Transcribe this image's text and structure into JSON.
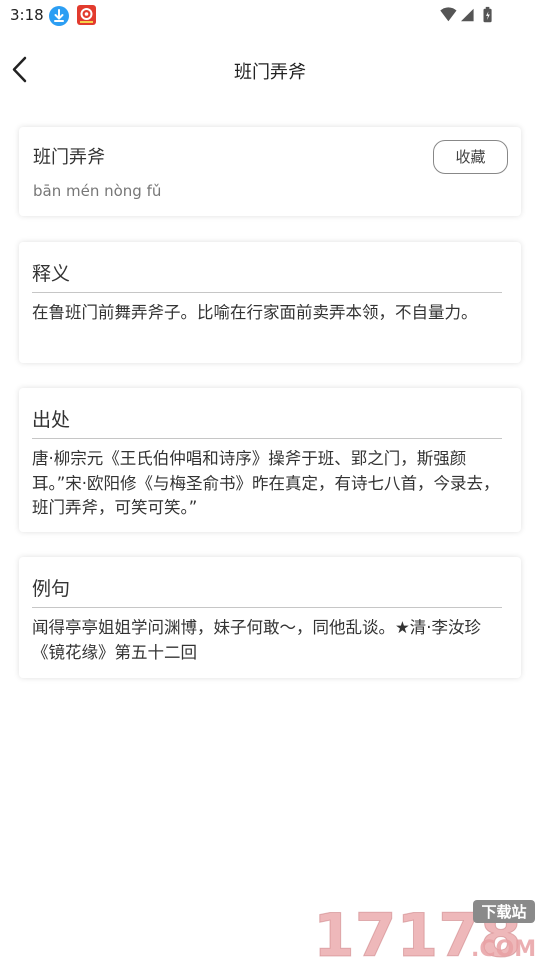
{
  "status_bar": {
    "time": "3:18",
    "icons": [
      "download-icon",
      "app-notification-icon",
      "wifi-icon",
      "signal-icon",
      "battery-icon"
    ]
  },
  "header": {
    "title": "班门弄斧",
    "back_icon": "chevron-left-icon"
  },
  "idiom": {
    "word": "班门弄斧",
    "pinyin": "bān mén nòng fǔ",
    "collect_label": "收藏"
  },
  "sections": [
    {
      "heading": "释义",
      "text": "在鲁班门前舞弄斧子。比喻在行家面前卖弄本领，不自量力。"
    },
    {
      "heading": "出处",
      "text": "唐·柳宗元《王氏伯仲唱和诗序》操斧于班、郢之门，斯强颜耳。”宋·欧阳修《与梅圣俞书》昨在真定，有诗七八首，今录去，班门弄斧，可笑可笑。”"
    },
    {
      "heading": "例句",
      "text": "闻得亭亭姐姐学问渊博，妹子何敢～，同他乱谈。★清·李汝珍《镜花缘》第五十二回"
    }
  ],
  "watermark": {
    "digits": "17178",
    "badge": "下载站",
    "domain": ".COM"
  },
  "colors": {
    "download_icon": "#2c9ef3",
    "app_icon": "#e23b2e",
    "watermark": "#e8a0a3"
  }
}
